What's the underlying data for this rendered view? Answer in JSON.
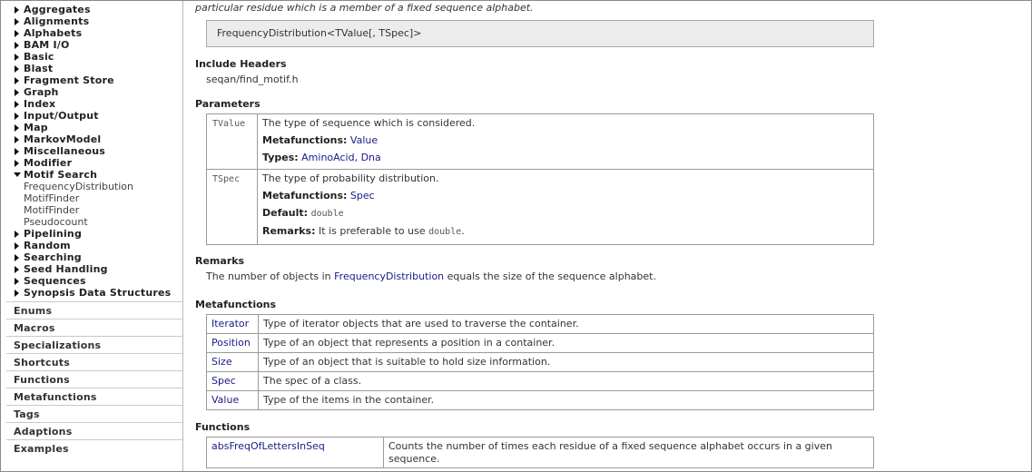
{
  "sidebar": {
    "categories": [
      {
        "label": "Aggregates",
        "open": false
      },
      {
        "label": "Alignments",
        "open": false
      },
      {
        "label": "Alphabets",
        "open": false
      },
      {
        "label": "BAM I/O",
        "open": false
      },
      {
        "label": "Basic",
        "open": false
      },
      {
        "label": "Blast",
        "open": false
      },
      {
        "label": "Fragment Store",
        "open": false
      },
      {
        "label": "Graph",
        "open": false
      },
      {
        "label": "Index",
        "open": false
      },
      {
        "label": "Input/Output",
        "open": false
      },
      {
        "label": "Map",
        "open": false
      },
      {
        "label": "MarkovModel",
        "open": false
      },
      {
        "label": "Miscellaneous",
        "open": false
      },
      {
        "label": "Modifier",
        "open": false
      },
      {
        "label": "Motif Search",
        "open": true,
        "children": [
          "FrequencyDistribution",
          "MotifFinder",
          "MotifFinder",
          "Pseudocount"
        ]
      },
      {
        "label": "Pipelining",
        "open": false
      },
      {
        "label": "Random",
        "open": false
      },
      {
        "label": "Searching",
        "open": false
      },
      {
        "label": "Seed Handling",
        "open": false
      },
      {
        "label": "Sequences",
        "open": false
      },
      {
        "label": "Synopsis Data Structures",
        "open": false
      }
    ],
    "sections": [
      "Enums",
      "Macros",
      "Specializations",
      "Shortcuts",
      "Functions",
      "Metafunctions",
      "Tags",
      "Adaptions",
      "Examples"
    ]
  },
  "main": {
    "intro": "particular residue which is a member of a fixed sequence alphabet.",
    "signature": "FrequencyDistribution<TValue[, TSpec]>",
    "include_heading": "Include Headers",
    "include_file": "seqan/find_motif.h",
    "params_heading": "Parameters",
    "params": {
      "tvalue": {
        "name": "TValue",
        "desc": "The type of sequence which is considered.",
        "metafunctions_label": "Metafunctions:",
        "metafunctions_value": "Value",
        "types_label": "Types:",
        "types_value": "AminoAcid, Dna"
      },
      "tspec": {
        "name": "TSpec",
        "desc": "The type of probability distribution.",
        "metafunctions_label": "Metafunctions:",
        "metafunctions_value": "Spec",
        "default_label": "Default:",
        "default_value": "double",
        "remarks_label": "Remarks:",
        "remarks_text": "It is preferable to use",
        "remarks_code": "double",
        "remarks_end": "."
      }
    },
    "remarks_heading": "Remarks",
    "remarks": {
      "before": "The number of objects in",
      "link": "FrequencyDistribution",
      "after": "equals the size of the sequence alphabet."
    },
    "metafunctions_heading": "Metafunctions",
    "metafunctions": [
      {
        "name": "Iterator",
        "desc": "Type of iterator objects that are used to traverse the container."
      },
      {
        "name": "Position",
        "desc": "Type of an object that represents a position in a container."
      },
      {
        "name": "Size",
        "desc": "Type of an object that is suitable to hold size information."
      },
      {
        "name": "Spec",
        "desc": "The spec of a class."
      },
      {
        "name": "Value",
        "desc": "Type of the items in the container."
      }
    ],
    "functions_heading": "Functions",
    "functions": [
      {
        "name": "absFreqOfLettersInSeq",
        "desc": "Counts the number of times each residue of a fixed sequence alphabet occurs in a given sequence."
      }
    ]
  }
}
